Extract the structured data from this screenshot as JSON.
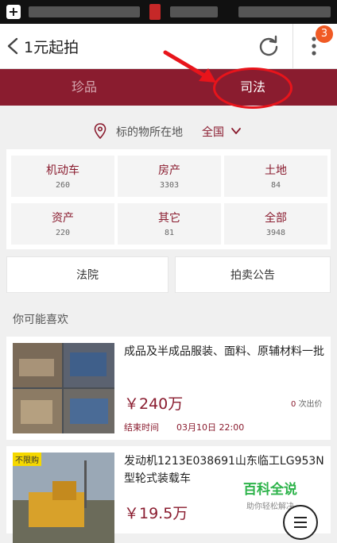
{
  "header": {
    "title": "1元起拍",
    "badge": "3"
  },
  "tabs": [
    {
      "label": "珍品"
    },
    {
      "label": "司法"
    }
  ],
  "location": {
    "label": "标的物所在地",
    "value": "全国"
  },
  "categories": [
    {
      "name": "机动车",
      "count": "260"
    },
    {
      "name": "房产",
      "count": "3303"
    },
    {
      "name": "土地",
      "count": "84"
    },
    {
      "name": "资产",
      "count": "220"
    },
    {
      "name": "其它",
      "count": "81"
    },
    {
      "name": "全部",
      "count": "3948"
    }
  ],
  "buttons": {
    "court": "法院",
    "notice": "拍卖公告"
  },
  "section_title": "你可能喜欢",
  "items": [
    {
      "title": "成品及半成品服装、面料、原辅材料一批",
      "price": "￥240万",
      "bids_count": "0",
      "bids_label": "次出价",
      "end_label": "结束时间",
      "end_time": "03月10日 22:00"
    },
    {
      "tag": "不限购",
      "title": "发动机1213E038691山东临工LG953N型轮式装载车",
      "price": "￥19.5万"
    }
  ],
  "watermark": {
    "title": "百科全说",
    "subtitle": "助你轻松解决"
  },
  "colors": {
    "brand": "#8a1c2f",
    "badge": "#f05a24",
    "annotation": "#e8141b",
    "watermark": "#2db34a"
  }
}
